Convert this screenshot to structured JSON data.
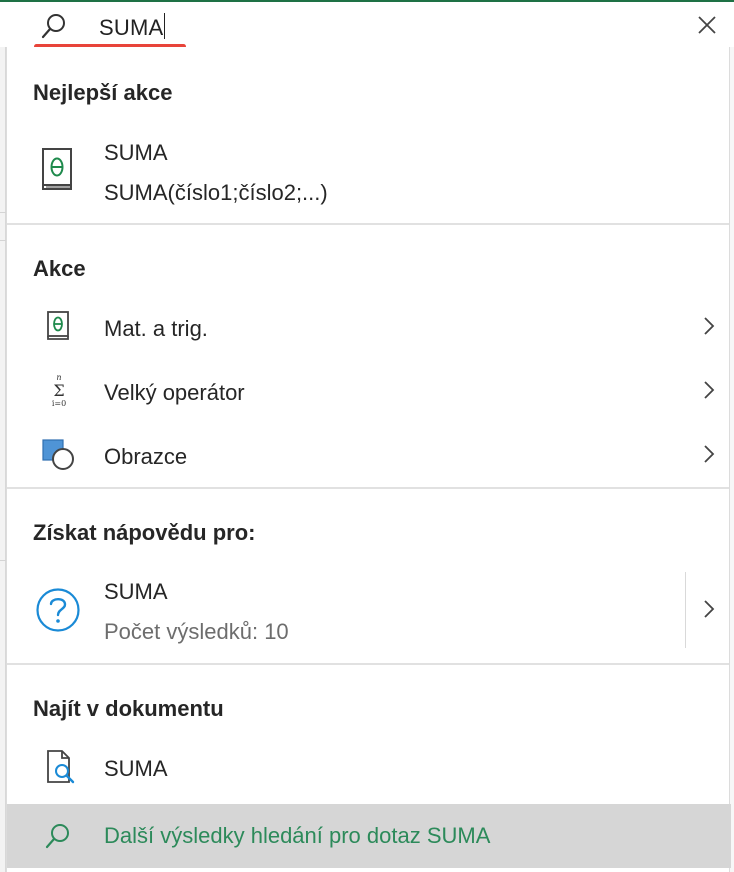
{
  "search": {
    "query": "SUMA",
    "search_icon": "search-icon",
    "close_icon": "close-icon",
    "accent_color": "#1e7145",
    "underline_color": "#e8443a"
  },
  "best_action": {
    "title": "Nejlepší akce",
    "item": {
      "icon": "function-book-icon",
      "name": "SUMA",
      "syntax": "SUMA(číslo1;číslo2;...)"
    }
  },
  "actions": {
    "title": "Akce",
    "items": [
      {
        "icon": "math-trig-book-icon",
        "label": "Mat. a trig."
      },
      {
        "icon": "sigma-operator-icon",
        "label": "Velký operátor"
      },
      {
        "icon": "shapes-icon",
        "label": "Obrazce"
      }
    ]
  },
  "help": {
    "title": "Získat nápovědu pro:",
    "item": {
      "icon": "help-question-icon",
      "name": "SUMA",
      "results": "Počet výsledků: 10"
    }
  },
  "find": {
    "title": "Najít v dokumentu",
    "item": {
      "icon": "document-search-icon",
      "label": "SUMA"
    }
  },
  "footer": {
    "icon": "search-icon",
    "label": "Další výsledky hledání pro dotaz SUMA"
  }
}
